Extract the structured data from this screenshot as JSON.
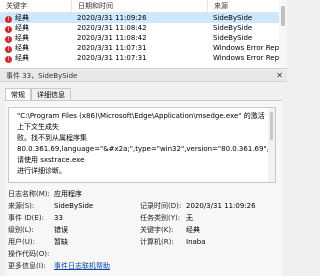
{
  "list": {
    "columns": [
      "关键字",
      "日期和时间",
      "来源"
    ],
    "rows": [
      {
        "level": "经典",
        "date": "2020/3/31 11:09:26",
        "source": "SideBySide",
        "selected": true
      },
      {
        "level": "经典",
        "date": "2020/3/31 11:08:42",
        "source": "SideBySide",
        "selected": false
      },
      {
        "level": "经典",
        "date": "2020/3/31 11:08:42",
        "source": "SideBySide",
        "selected": false
      },
      {
        "level": "经典",
        "date": "2020/3/31 11:07:31",
        "source": "Windows Error Reporting",
        "selected": false
      },
      {
        "level": "经典",
        "date": "2020/3/31 11:07:31",
        "source": "Windows Error Reporting",
        "selected": false
      }
    ]
  },
  "detail": {
    "title": "事件 33，SideBySide",
    "tabs": [
      "常规",
      "详细信息"
    ],
    "message_lines": [
      "\"C:\\Program Files (x86)\\Microsoft\\Edge\\Application\\msedge.exe\" 的激活上下文生成失",
      "败。找不到从属程序集",
      "80.0.361.69,language=\"&#x2a;\",type=\"win32\",version=\"80.0.361.69\"。请使用 sxstrace.exe",
      "进行详细诊断。"
    ]
  },
  "props": {
    "log_name_label": "日志名称(M):",
    "log_name": "应用程序",
    "source_label": "来源(S):",
    "source": "SideBySide",
    "logged_label": "记录时间(D):",
    "logged": "2020/3/31 11:09:26",
    "event_id_label": "事件 ID(E):",
    "event_id": "33",
    "task_label": "任务类别(Y):",
    "task": "无",
    "level_label": "级别(L):",
    "level": "错误",
    "keywords_label": "关键字(K):",
    "keywords": "经典",
    "user_label": "用户(U):",
    "user": "暂缺",
    "computer_label": "计算机(R):",
    "computer": "Inaba",
    "opcode_label": "操作代码(O):",
    "opcode": "",
    "more_label": "更多信息(I):",
    "more_link": "事件日志联机帮助"
  },
  "colors": {
    "selected_row": "#cce8ff",
    "error_icon": "#d8262c",
    "link": "#0645ad"
  }
}
